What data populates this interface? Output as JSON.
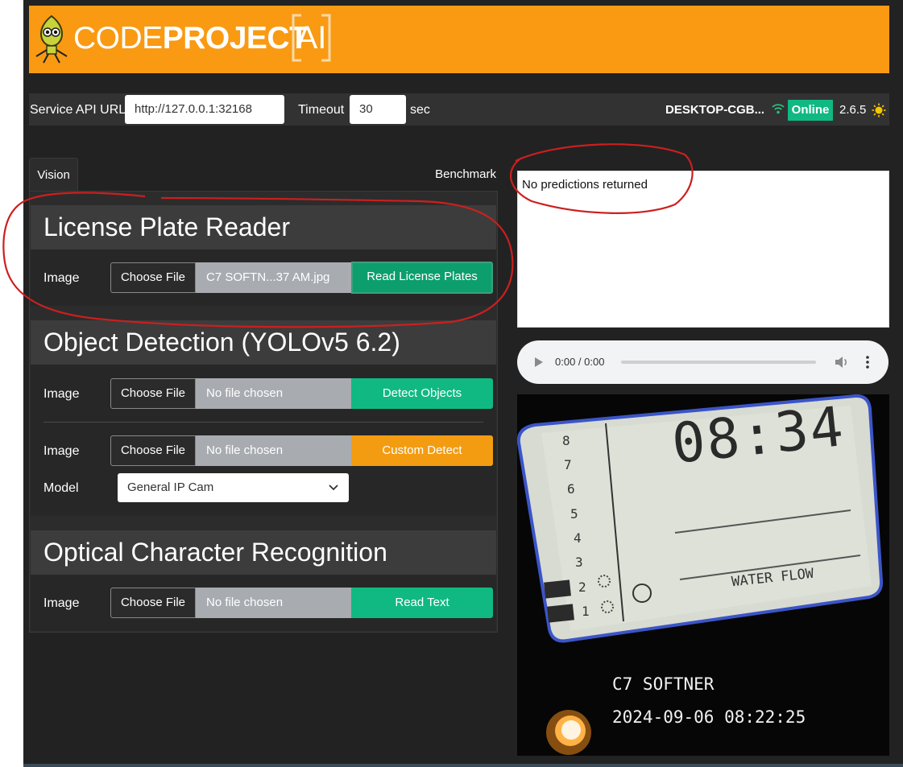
{
  "brand": {
    "logo_light": "CODE",
    "logo_bold": "PROJECT",
    "logo_ai": "AI"
  },
  "service": {
    "api_url_label": "Service API URL",
    "api_url_value": "http://127.0.0.1:32168",
    "timeout_label": "Timeout",
    "timeout_value": "30",
    "timeout_unit": "sec",
    "hostname": "DESKTOP-CGB...",
    "status": "Online",
    "version": "2.6.5"
  },
  "tabs": {
    "vision": "Vision",
    "benchmark": "Benchmark"
  },
  "lpr": {
    "title": "License Plate Reader",
    "image_label": "Image",
    "choose_label": "Choose File",
    "file_name": "C7 SOFTN...37 AM.jpg",
    "action_label": "Read License Plates"
  },
  "objdet": {
    "title": "Object Detection (YOLOv5 6.2)",
    "image_label": "Image",
    "choose_label": "Choose File",
    "file_name": "No file chosen",
    "action_label": "Detect Objects",
    "custom_image_label": "Image",
    "custom_choose_label": "Choose File",
    "custom_file_name": "No file chosen",
    "custom_action_label": "Custom Detect",
    "model_label": "Model",
    "model_value": "General IP Cam"
  },
  "ocr": {
    "title": "Optical Character Recognition",
    "image_label": "Image",
    "choose_label": "Choose File",
    "file_name": "No file chosen",
    "action_label": "Read Text"
  },
  "results": {
    "text": "No predictions returned"
  },
  "audio": {
    "time": "0:00 / 0:00"
  },
  "photo": {
    "display_time": "08:34",
    "scale_numbers": [
      "8",
      "7",
      "6",
      "5",
      "4",
      "3",
      "2",
      "1"
    ],
    "panel_label": "WATER FLOW",
    "overlay_name": "C7 SOFTNER",
    "overlay_datetime": "2024-09-06 08:22:25"
  },
  "colors": {
    "brand_orange": "#f99a12",
    "online_green": "#10b981",
    "custom_orange": "#f39c12",
    "annotation_red": "#cc1f1f"
  }
}
